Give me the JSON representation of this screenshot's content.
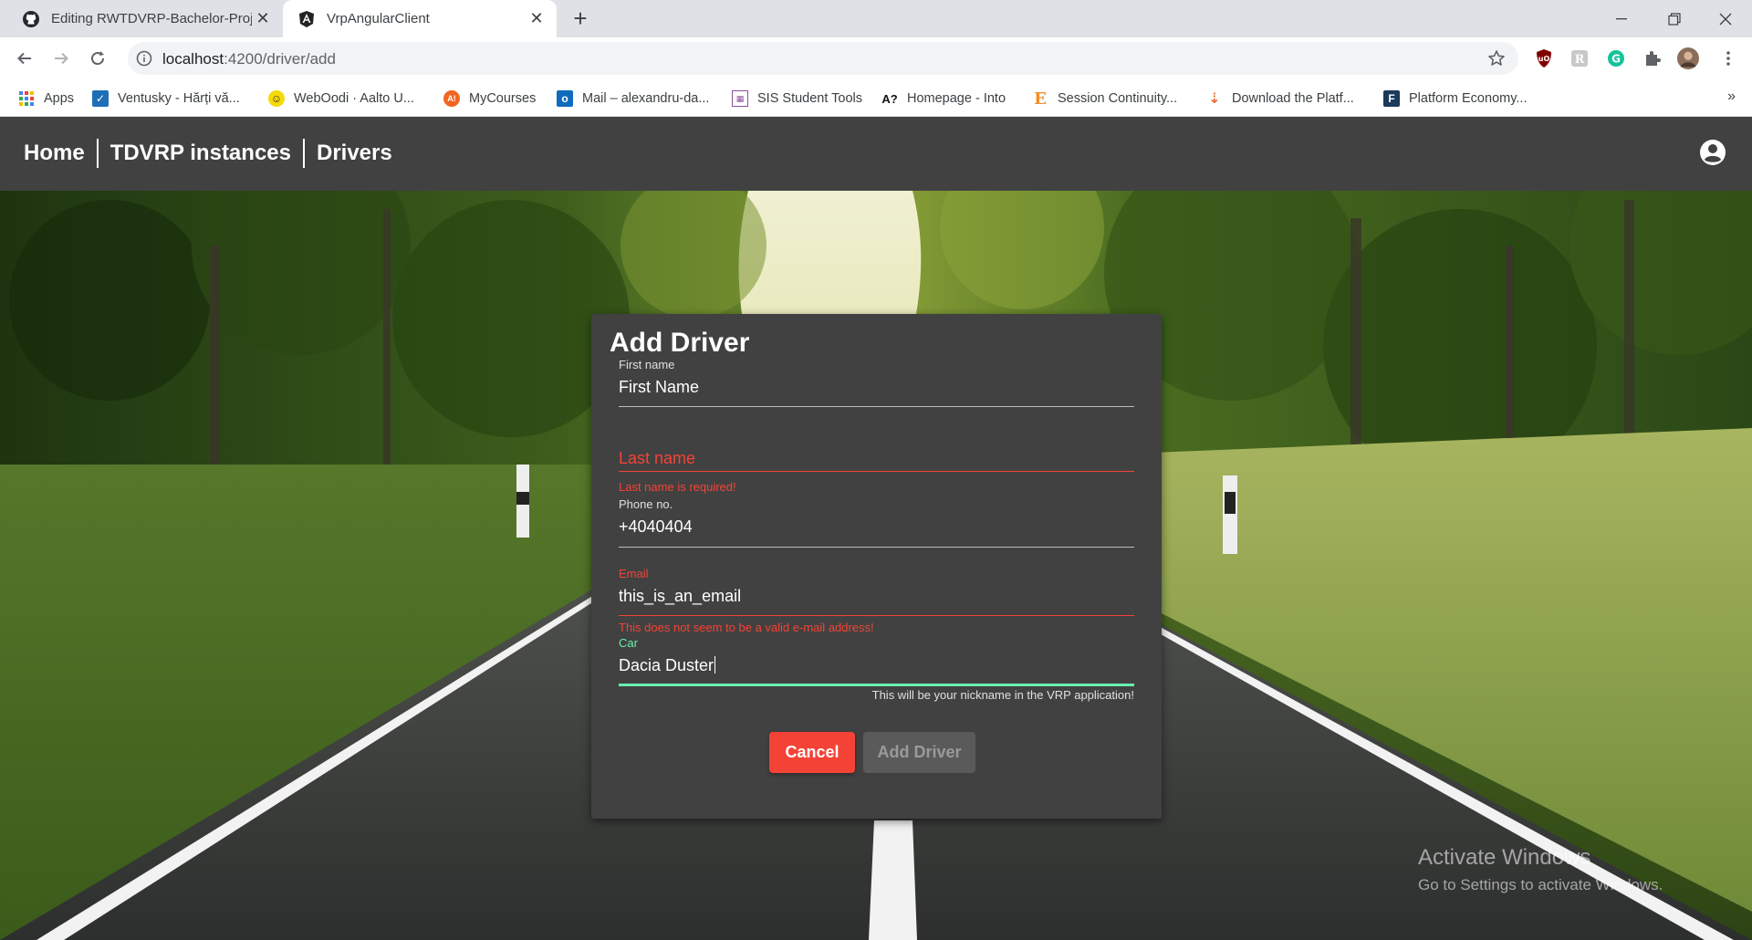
{
  "browser": {
    "tabs": [
      {
        "title": "Editing RWTDVRP-Bachelor-Proje",
        "icon": "github-icon",
        "active": false
      },
      {
        "title": "VrpAngularClient",
        "icon": "angular-icon",
        "active": true
      }
    ],
    "url_host": "localhost",
    "url_path": ":4200/driver/add",
    "bookmarks": [
      {
        "label": "Apps",
        "icon": "apps-grid-icon"
      },
      {
        "label": "Ventusky - Hărți vă...",
        "icon": "ventusky-icon"
      },
      {
        "label": "WebOodi · Aalto U...",
        "icon": "weboodi-icon"
      },
      {
        "label": "MyCourses",
        "icon": "aalto-icon"
      },
      {
        "label": "Mail – alexandru-da...",
        "icon": "outlook-icon"
      },
      {
        "label": "SIS Student Tools",
        "icon": "sis-icon"
      },
      {
        "label": "Homepage - Into",
        "icon": "into-icon"
      },
      {
        "label": "Session Continuity...",
        "icon": "e-icon"
      },
      {
        "label": "Download the Platf...",
        "icon": "platform-download-icon"
      },
      {
        "label": "Platform Economy...",
        "icon": "f-icon"
      }
    ],
    "more_bookmarks": "»"
  },
  "nav": {
    "home": "Home",
    "instances": "TDVRP instances",
    "drivers": "Drivers"
  },
  "form": {
    "title": "Add Driver",
    "first_name": {
      "label": "First name",
      "value": "First Name"
    },
    "last_name": {
      "placeholder": "Last name",
      "error": "Last name is required!"
    },
    "phone": {
      "label": "Phone no.",
      "value": "+4040404"
    },
    "email": {
      "label": "Email",
      "value": "this_is_an_email",
      "error": "This does not seem to be a valid e-mail address!"
    },
    "car": {
      "label": "Car",
      "value": "Dacia Duster",
      "hint": "This will be your nickname in the VRP application!"
    },
    "cancel": "Cancel",
    "submit": "Add Driver"
  },
  "watermark": {
    "line1": "Activate Windows",
    "line2": "Go to Settings to activate Windows."
  },
  "colors": {
    "appbar": "#414141",
    "card": "#414141",
    "error": "#f44336",
    "focus": "#69f0ae"
  }
}
